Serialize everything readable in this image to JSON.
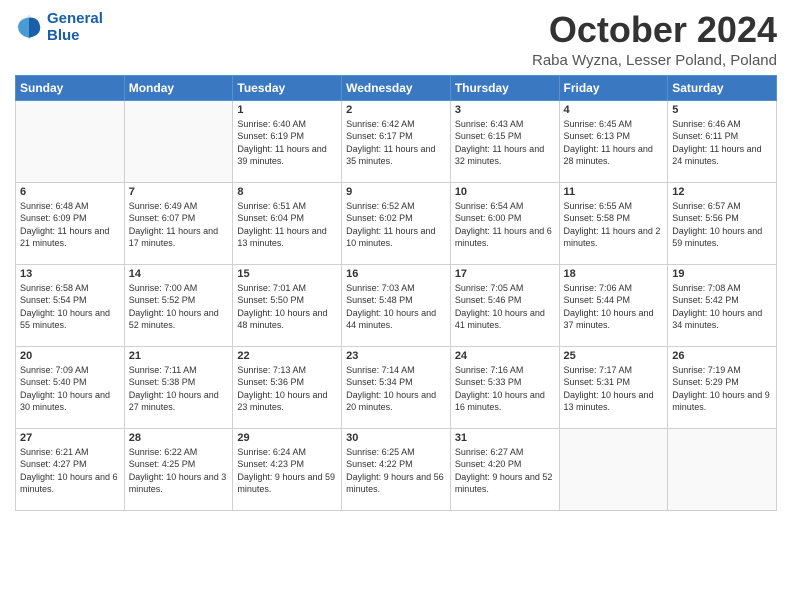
{
  "logo": {
    "line1": "General",
    "line2": "Blue"
  },
  "title": "October 2024",
  "subtitle": "Raba Wyzna, Lesser Poland, Poland",
  "days_of_week": [
    "Sunday",
    "Monday",
    "Tuesday",
    "Wednesday",
    "Thursday",
    "Friday",
    "Saturday"
  ],
  "weeks": [
    [
      {
        "num": "",
        "info": ""
      },
      {
        "num": "",
        "info": ""
      },
      {
        "num": "1",
        "info": "Sunrise: 6:40 AM\nSunset: 6:19 PM\nDaylight: 11 hours and 39 minutes."
      },
      {
        "num": "2",
        "info": "Sunrise: 6:42 AM\nSunset: 6:17 PM\nDaylight: 11 hours and 35 minutes."
      },
      {
        "num": "3",
        "info": "Sunrise: 6:43 AM\nSunset: 6:15 PM\nDaylight: 11 hours and 32 minutes."
      },
      {
        "num": "4",
        "info": "Sunrise: 6:45 AM\nSunset: 6:13 PM\nDaylight: 11 hours and 28 minutes."
      },
      {
        "num": "5",
        "info": "Sunrise: 6:46 AM\nSunset: 6:11 PM\nDaylight: 11 hours and 24 minutes."
      }
    ],
    [
      {
        "num": "6",
        "info": "Sunrise: 6:48 AM\nSunset: 6:09 PM\nDaylight: 11 hours and 21 minutes."
      },
      {
        "num": "7",
        "info": "Sunrise: 6:49 AM\nSunset: 6:07 PM\nDaylight: 11 hours and 17 minutes."
      },
      {
        "num": "8",
        "info": "Sunrise: 6:51 AM\nSunset: 6:04 PM\nDaylight: 11 hours and 13 minutes."
      },
      {
        "num": "9",
        "info": "Sunrise: 6:52 AM\nSunset: 6:02 PM\nDaylight: 11 hours and 10 minutes."
      },
      {
        "num": "10",
        "info": "Sunrise: 6:54 AM\nSunset: 6:00 PM\nDaylight: 11 hours and 6 minutes."
      },
      {
        "num": "11",
        "info": "Sunrise: 6:55 AM\nSunset: 5:58 PM\nDaylight: 11 hours and 2 minutes."
      },
      {
        "num": "12",
        "info": "Sunrise: 6:57 AM\nSunset: 5:56 PM\nDaylight: 10 hours and 59 minutes."
      }
    ],
    [
      {
        "num": "13",
        "info": "Sunrise: 6:58 AM\nSunset: 5:54 PM\nDaylight: 10 hours and 55 minutes."
      },
      {
        "num": "14",
        "info": "Sunrise: 7:00 AM\nSunset: 5:52 PM\nDaylight: 10 hours and 52 minutes."
      },
      {
        "num": "15",
        "info": "Sunrise: 7:01 AM\nSunset: 5:50 PM\nDaylight: 10 hours and 48 minutes."
      },
      {
        "num": "16",
        "info": "Sunrise: 7:03 AM\nSunset: 5:48 PM\nDaylight: 10 hours and 44 minutes."
      },
      {
        "num": "17",
        "info": "Sunrise: 7:05 AM\nSunset: 5:46 PM\nDaylight: 10 hours and 41 minutes."
      },
      {
        "num": "18",
        "info": "Sunrise: 7:06 AM\nSunset: 5:44 PM\nDaylight: 10 hours and 37 minutes."
      },
      {
        "num": "19",
        "info": "Sunrise: 7:08 AM\nSunset: 5:42 PM\nDaylight: 10 hours and 34 minutes."
      }
    ],
    [
      {
        "num": "20",
        "info": "Sunrise: 7:09 AM\nSunset: 5:40 PM\nDaylight: 10 hours and 30 minutes."
      },
      {
        "num": "21",
        "info": "Sunrise: 7:11 AM\nSunset: 5:38 PM\nDaylight: 10 hours and 27 minutes."
      },
      {
        "num": "22",
        "info": "Sunrise: 7:13 AM\nSunset: 5:36 PM\nDaylight: 10 hours and 23 minutes."
      },
      {
        "num": "23",
        "info": "Sunrise: 7:14 AM\nSunset: 5:34 PM\nDaylight: 10 hours and 20 minutes."
      },
      {
        "num": "24",
        "info": "Sunrise: 7:16 AM\nSunset: 5:33 PM\nDaylight: 10 hours and 16 minutes."
      },
      {
        "num": "25",
        "info": "Sunrise: 7:17 AM\nSunset: 5:31 PM\nDaylight: 10 hours and 13 minutes."
      },
      {
        "num": "26",
        "info": "Sunrise: 7:19 AM\nSunset: 5:29 PM\nDaylight: 10 hours and 9 minutes."
      }
    ],
    [
      {
        "num": "27",
        "info": "Sunrise: 6:21 AM\nSunset: 4:27 PM\nDaylight: 10 hours and 6 minutes."
      },
      {
        "num": "28",
        "info": "Sunrise: 6:22 AM\nSunset: 4:25 PM\nDaylight: 10 hours and 3 minutes."
      },
      {
        "num": "29",
        "info": "Sunrise: 6:24 AM\nSunset: 4:23 PM\nDaylight: 9 hours and 59 minutes."
      },
      {
        "num": "30",
        "info": "Sunrise: 6:25 AM\nSunset: 4:22 PM\nDaylight: 9 hours and 56 minutes."
      },
      {
        "num": "31",
        "info": "Sunrise: 6:27 AM\nSunset: 4:20 PM\nDaylight: 9 hours and 52 minutes."
      },
      {
        "num": "",
        "info": ""
      },
      {
        "num": "",
        "info": ""
      }
    ]
  ]
}
